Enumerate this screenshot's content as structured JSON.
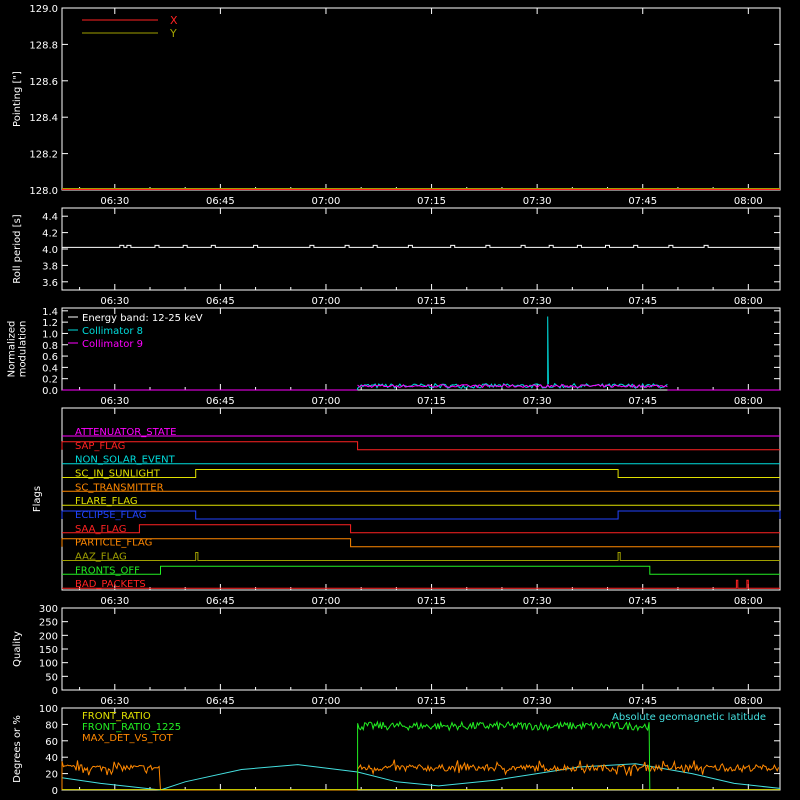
{
  "time_axis": {
    "ticks": [
      {
        "t": 30,
        "label": "06:30"
      },
      {
        "t": 45,
        "label": "06:45"
      },
      {
        "t": 60,
        "label": "07:00"
      },
      {
        "t": 75,
        "label": "07:15"
      },
      {
        "t": 90,
        "label": "07:30"
      },
      {
        "t": 105,
        "label": "07:45"
      },
      {
        "t": 120,
        "label": "08:00"
      }
    ],
    "range_minutes_after_0600": [
      22.5,
      124.5
    ]
  },
  "colors": {
    "red": "#ff2222",
    "yellow": "#e0e000",
    "olive": "#a0a000",
    "cyan": "#00dddd",
    "magenta": "#ff00ff",
    "orange": "#ff8800",
    "green": "#22ee22",
    "blue": "#2244ff",
    "white": "#ffffff",
    "lightcyan": "#44e0e0"
  },
  "chart_data": [
    {
      "id": "pointing",
      "type": "line",
      "ylabel": "Pointing [\"]",
      "ylim": [
        128.0,
        129.0
      ],
      "yticks": [
        "128.0",
        "128.2",
        "128.4",
        "128.6",
        "128.8",
        "129.0"
      ],
      "legend": [
        "X",
        "Y"
      ],
      "series": [
        {
          "name": "X",
          "color": "red",
          "x": [
            22.5,
            124.5
          ],
          "y": [
            128.0,
            128.0
          ]
        },
        {
          "name": "Y",
          "color": "olive",
          "x": [
            22.5,
            124.5
          ],
          "y": [
            128.0,
            128.0
          ]
        }
      ]
    },
    {
      "id": "roll",
      "type": "line",
      "ylabel": "Roll period [s]",
      "ylim": [
        3.5,
        4.5
      ],
      "yticks": [
        "3.6",
        "3.8",
        "4.0",
        "4.2",
        "4.4"
      ],
      "series": [
        {
          "color": "white",
          "x": [
            22.5,
            124.5
          ],
          "y": [
            4.02,
            4.02
          ],
          "blips_at": [
            31,
            32,
            36,
            40,
            44,
            50,
            58,
            63,
            67,
            72,
            78,
            83,
            88,
            92,
            96,
            100,
            104,
            109,
            114
          ]
        }
      ]
    },
    {
      "id": "modulation",
      "type": "line",
      "ylabel": [
        "Normalized",
        "modulation"
      ],
      "ylim": [
        0.0,
        1.45
      ],
      "yticks": [
        "0.0",
        "0.2",
        "0.4",
        "0.6",
        "0.8",
        "1.0",
        "1.2",
        "1.4"
      ],
      "legend": [
        "Energy band: 12-25 keV",
        "Collimator 8",
        "Collimator 9"
      ],
      "series": [
        {
          "name": "Collimator 8",
          "color": "cyan",
          "active": [
            64.5,
            108.5
          ],
          "base": 0.08,
          "spike": {
            "x": 91.5,
            "y": 1.3
          }
        },
        {
          "name": "Collimator 9",
          "color": "magenta",
          "active": [
            64.5,
            108.5
          ],
          "base": 0.07
        }
      ]
    },
    {
      "id": "flags",
      "type": "line",
      "ylabel": "Flags",
      "rows": [
        {
          "label": "ATTENUATOR_STATE",
          "color": "magenta",
          "steps": []
        },
        {
          "label": "SAP_FLAG",
          "color": "red",
          "steps": [
            {
              "from": 22.5,
              "to": 64.5,
              "high": true
            }
          ]
        },
        {
          "label": "NON_SOLAR_EVENT",
          "color": "cyan",
          "steps": []
        },
        {
          "label": "SC_IN_SUNLIGHT",
          "color": "yellow",
          "steps": [
            {
              "from": 41.5,
              "to": 101.5,
              "high": true
            }
          ]
        },
        {
          "label": "SC_TRANSMITTER",
          "color": "orange",
          "steps": []
        },
        {
          "label": "FLARE_FLAG",
          "color": "yellow",
          "steps": []
        },
        {
          "label": "ECLIPSE_FLAG",
          "color": "blue",
          "steps": [
            {
              "from": 22.5,
              "to": 41.5,
              "high": true
            },
            {
              "from": 101.5,
              "to": 124.5,
              "high": true
            }
          ]
        },
        {
          "label": "SAA_FLAG",
          "color": "red",
          "steps": [
            {
              "from": 33.5,
              "to": 63.5,
              "high": true
            }
          ]
        },
        {
          "label": "PARTICLE_FLAG",
          "color": "orange",
          "steps": [
            {
              "from": 22.5,
              "to": 63.5,
              "high": true
            }
          ]
        },
        {
          "label": "AAZ_FLAG",
          "color": "olive",
          "steps": [
            {
              "from": 41.5,
              "to": 41.8,
              "high": true
            },
            {
              "from": 101.5,
              "to": 101.8,
              "high": true
            }
          ]
        },
        {
          "label": "FRONTS_OFF",
          "color": "green",
          "steps": [
            {
              "from": 36.5,
              "to": 106.0,
              "high": true
            }
          ]
        },
        {
          "label": "BAD_PACKETS",
          "color": "red",
          "steps": [
            {
              "from": 118.3,
              "to": 118.5,
              "high": true
            },
            {
              "from": 119.8,
              "to": 120.0,
              "high": true
            }
          ]
        }
      ]
    },
    {
      "id": "quality",
      "type": "line",
      "ylabel": "Quality",
      "ylim": [
        0,
        300
      ],
      "yticks": [
        "0",
        "50",
        "100",
        "150",
        "200",
        "250",
        "300"
      ],
      "series": [
        {
          "color": "white",
          "x": [
            22.5,
            124.5
          ],
          "y": [
            300,
            300
          ]
        }
      ]
    },
    {
      "id": "ratio",
      "type": "line",
      "ylabel": "Degrees or %",
      "ylim": [
        0,
        100
      ],
      "yticks": [
        "0",
        "20",
        "40",
        "60",
        "80",
        "100"
      ],
      "legend_left": [
        "FRONT_RATIO",
        "FRONT_RATIO_1225",
        "MAX_DET_VS_TOT"
      ],
      "legend_right": "Absolute geomagnetic latitude",
      "series": [
        {
          "name": "FRONT_RATIO",
          "color": "yellow",
          "note": "flat near zero"
        },
        {
          "name": "FRONT_RATIO_1225",
          "color": "green",
          "active": [
            64.5,
            106.0
          ],
          "mean": 78,
          "noise": 5
        },
        {
          "name": "MAX_DET_VS_TOT",
          "color": "orange",
          "segments": [
            [
              22.5,
              36.5,
              27
            ],
            [
              64.5,
              124.5,
              27
            ]
          ],
          "noise": 4
        },
        {
          "name": "Absolute geomagnetic latitude",
          "color": "lightcyan",
          "x": [
            22.5,
            28,
            36.5,
            40,
            48,
            56,
            64.5,
            70,
            76,
            84,
            90,
            96,
            104,
            112,
            118,
            124.5
          ],
          "y": [
            15,
            8,
            0,
            10,
            25,
            31,
            22,
            10,
            5,
            12,
            20,
            28,
            32,
            20,
            8,
            2
          ]
        }
      ]
    }
  ]
}
